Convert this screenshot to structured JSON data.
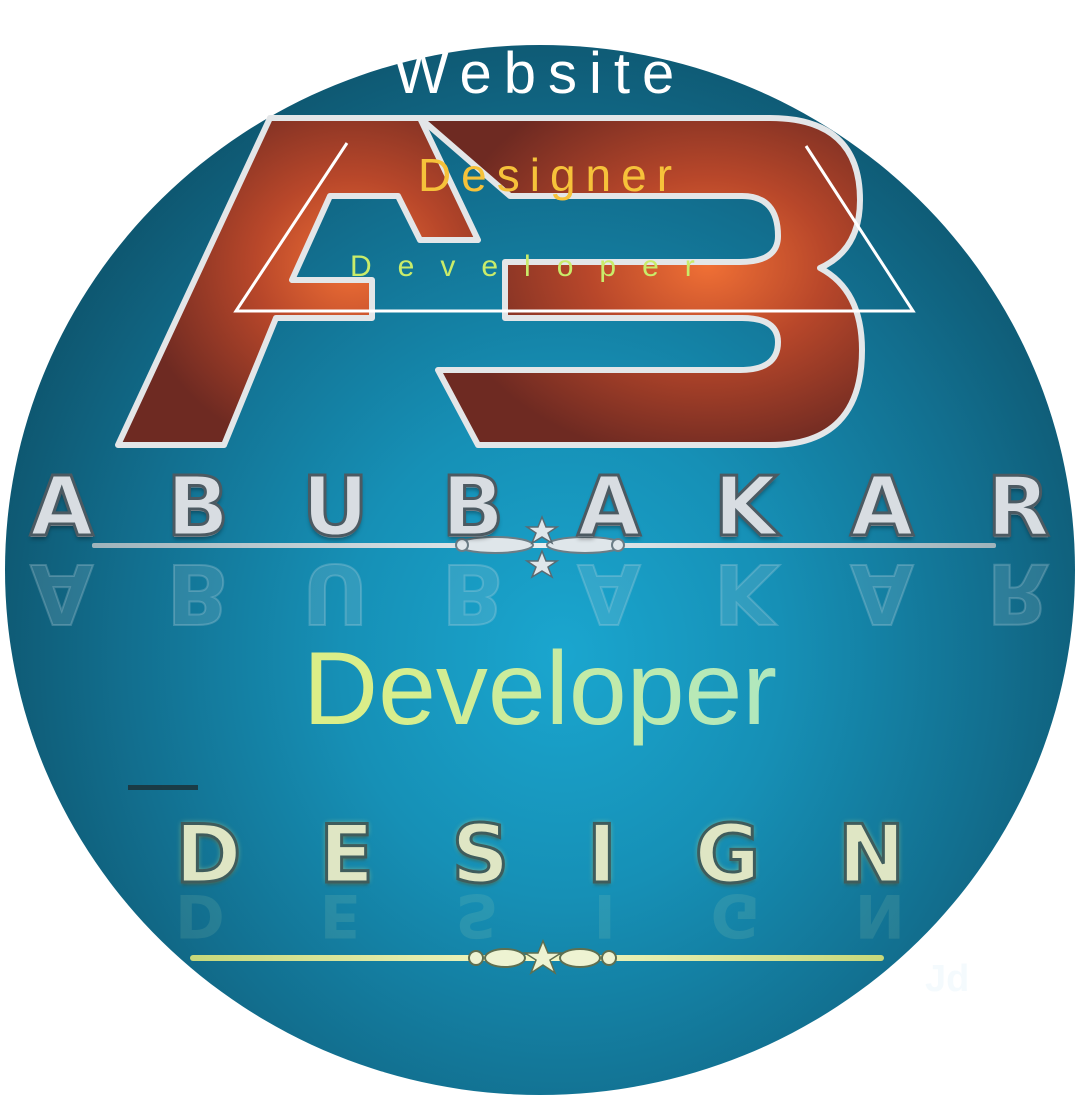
{
  "texts": {
    "website": "Website",
    "designer": "Designer",
    "developer_small": "Developer",
    "developer_big": "Developer",
    "watermark": "Jd"
  },
  "brand_letters": [
    "A",
    "B",
    "U",
    "B",
    "A",
    "K",
    "A",
    "R"
  ],
  "design_letters": [
    "D",
    "E",
    "S",
    "I",
    "G",
    "N"
  ],
  "logo": {
    "monogram": "AB",
    "colors": {
      "monogram_fill": "#b3492a",
      "monogram_outline": "#dfe3e6",
      "background": "#1690b6"
    }
  },
  "colors": {
    "website": "#ffffff",
    "designer": "#f6c23a",
    "developer_small": "#c9ec6a"
  }
}
